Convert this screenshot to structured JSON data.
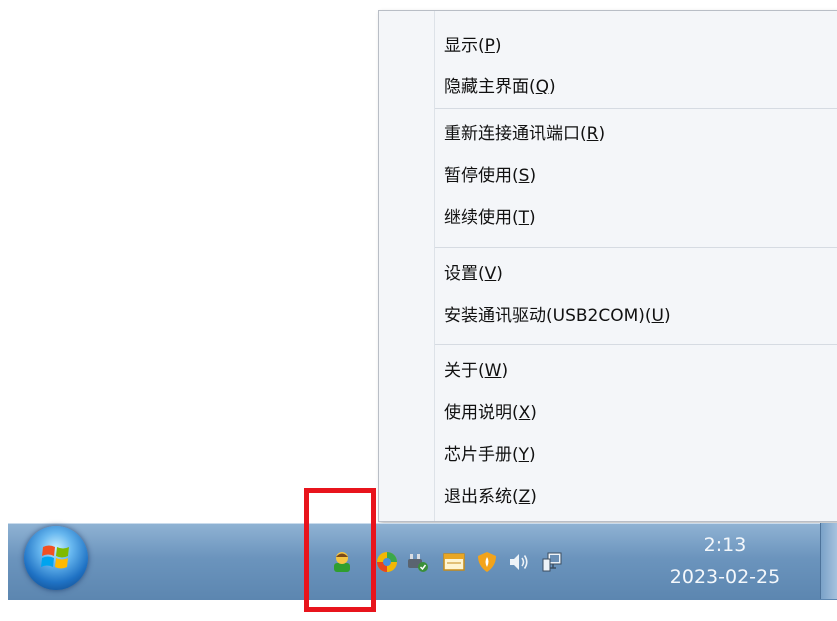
{
  "context_menu": {
    "items": [
      {
        "label": "显示(",
        "key": "P",
        "end": ")"
      },
      {
        "label": "隐藏主界面(",
        "key": "Q",
        "end": ")"
      },
      {
        "label": "重新连接通讯端口(",
        "key": "R",
        "end": ")"
      },
      {
        "label": "暂停使用(",
        "key": "S",
        "end": ")"
      },
      {
        "label": "继续使用(",
        "key": "T",
        "end": ")"
      },
      {
        "label": "设置(",
        "key": "V",
        "end": ")"
      },
      {
        "label": "安装通讯驱动(USB2COM)(",
        "key": "U",
        "end": ")"
      },
      {
        "label": "关于(",
        "key": "W",
        "end": ")"
      },
      {
        "label": "使用说明(",
        "key": "X",
        "end": ")"
      },
      {
        "label": "芯片手册(",
        "key": "Y",
        "end": ")"
      },
      {
        "label": "退出系统(",
        "key": "Z",
        "end": ")"
      }
    ]
  },
  "taskbar": {
    "clock_time": "2:13",
    "clock_date": "2023-02-25",
    "tray_icons": [
      "user-app-icon",
      "browser-icon",
      "power-plug-icon",
      "window-icon",
      "security-shield-icon",
      "speaker-icon",
      "network-icon"
    ]
  },
  "colors": {
    "highlight": "#e8141c",
    "taskbar": "#6b94bd"
  }
}
